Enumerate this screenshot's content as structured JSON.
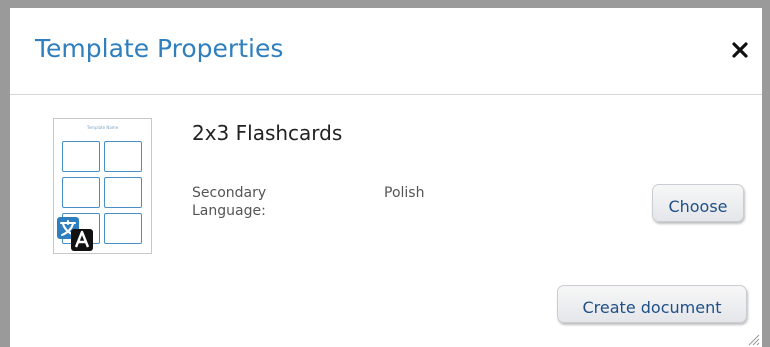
{
  "dialog": {
    "title": "Template Properties",
    "close_icon": "close-icon"
  },
  "template": {
    "thumbnail_caption": "Template Name",
    "name": "2x3 Flashcards",
    "secondary_language_label": "Secondary Language:",
    "secondary_language_value": "Polish"
  },
  "buttons": {
    "choose_label": "Choose",
    "create_document_label": "Create document"
  },
  "colors": {
    "title": "#2f7fbf",
    "button_text": "#1f4f86",
    "card_border": "#4a90c8",
    "translate_icon": "#2f7fbf"
  }
}
